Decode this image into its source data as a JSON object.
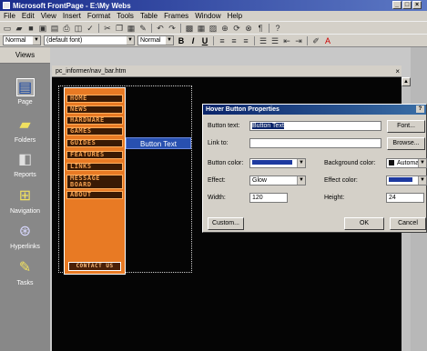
{
  "window": {
    "title": "Microsoft FrontPage - E:\\My Webs",
    "min": "_",
    "max": "□",
    "close": "×"
  },
  "menu": [
    "File",
    "Edit",
    "View",
    "Insert",
    "Format",
    "Tools",
    "Table",
    "Frames",
    "Window",
    "Help"
  ],
  "format_bar": {
    "style": "Normal",
    "font": "(default font)",
    "size": "Normal"
  },
  "views": {
    "header": "Views",
    "items": [
      {
        "label": "Page",
        "icon": "page-icon"
      },
      {
        "label": "Folders",
        "icon": "folder-icon"
      },
      {
        "label": "Reports",
        "icon": "reports-icon"
      },
      {
        "label": "Navigation",
        "icon": "navigation-icon"
      },
      {
        "label": "Hyperlinks",
        "icon": "hyperlinks-icon"
      },
      {
        "label": "Tasks",
        "icon": "tasks-icon"
      }
    ]
  },
  "document": {
    "tab_title": "pc_informer/nav_bar.htm"
  },
  "nav_buttons": [
    "HOME",
    "NEWS",
    "HARDWARE",
    "GAMES",
    "GUIDES",
    "FEATURES",
    "LINKS",
    "MESSAGE BOARD",
    "ABOUT"
  ],
  "selected_button_text": "Button Text",
  "contact_button": "CONTACT US",
  "dialog": {
    "title": "Hover Button Properties",
    "help": "?",
    "button_text_label": "Button text:",
    "button_text_value": "Button Text",
    "font_button": "Font...",
    "link_label": "Link to:",
    "link_value": "",
    "browse_button": "Browse...",
    "button_color_label": "Button color:",
    "background_color_label": "Background color:",
    "background_color_value": "Automa",
    "effect_label": "Effect:",
    "effect_value": "Glow",
    "effect_color_label": "Effect color:",
    "width_label": "Width:",
    "width_value": "120",
    "height_label": "Height:",
    "height_value": "24",
    "custom_button": "Custom...",
    "ok_button": "OK",
    "cancel_button": "Cancel"
  },
  "colors": {
    "nav_orange": "#e87a24",
    "button_color": "#1e3aa0",
    "title_blue": "#0a246a"
  }
}
